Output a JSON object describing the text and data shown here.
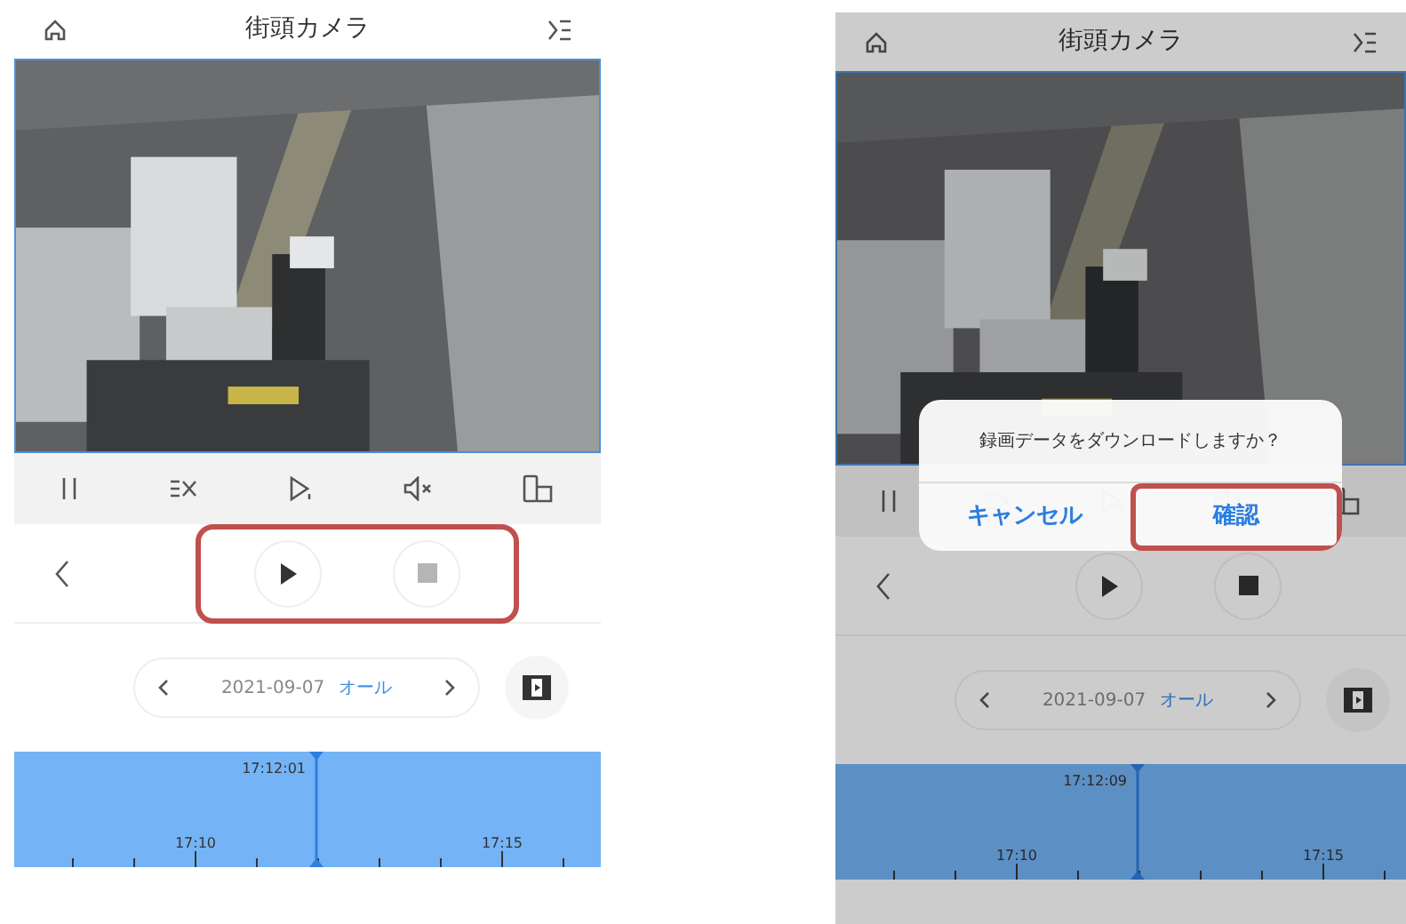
{
  "screens": [
    {
      "title": "街頭カメラ",
      "controls_highlighted": true,
      "stop_disabled": true,
      "date": "2021-09-07",
      "date_filter": "オール",
      "timeline": {
        "time": "17:12:01",
        "tick_labels": [
          "17:10",
          "17:15"
        ]
      }
    },
    {
      "title": "街頭カメラ",
      "dimmed": true,
      "controls_highlighted": false,
      "stop_disabled": false,
      "date": "2021-09-07",
      "date_filter": "オール",
      "timeline": {
        "time": "17:12:09",
        "tick_labels": [
          "17:10",
          "17:15"
        ]
      },
      "dialog": {
        "message": "録画データをダウンロードしますか？",
        "buttons": [
          {
            "label": "キャンセル",
            "highlighted": false
          },
          {
            "label": "確認",
            "highlighted": true
          }
        ]
      }
    }
  ]
}
